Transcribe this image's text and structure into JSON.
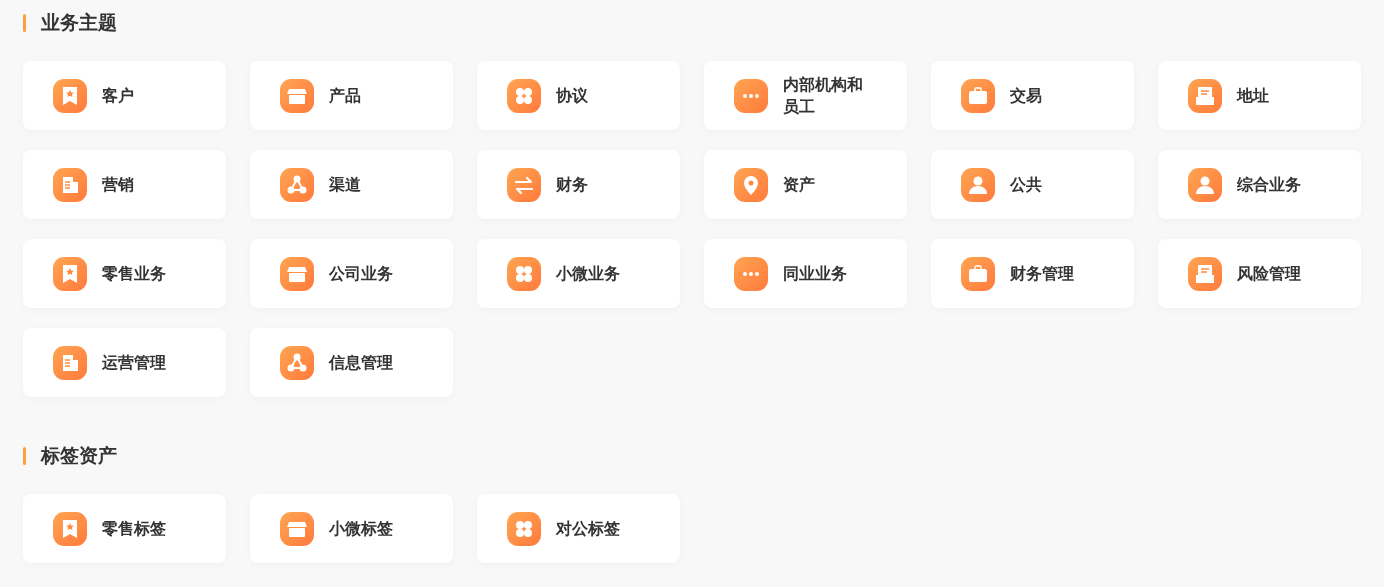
{
  "sections": [
    {
      "title": "业务主题",
      "items": [
        {
          "label": "客户",
          "kind": "bookmark"
        },
        {
          "label": "产品",
          "kind": "store"
        },
        {
          "label": "协议",
          "kind": "grid"
        },
        {
          "label": "内部机构和员工",
          "kind": "dots"
        },
        {
          "label": "交易",
          "kind": "briefcase"
        },
        {
          "label": "地址",
          "kind": "inbox"
        },
        {
          "label": "营销",
          "kind": "building"
        },
        {
          "label": "渠道",
          "kind": "nodes"
        },
        {
          "label": "财务",
          "kind": "swap"
        },
        {
          "label": "资产",
          "kind": "pin"
        },
        {
          "label": "公共",
          "kind": "person"
        },
        {
          "label": "综合业务",
          "kind": "person"
        },
        {
          "label": "零售业务",
          "kind": "bookmark"
        },
        {
          "label": "公司业务",
          "kind": "store"
        },
        {
          "label": "小微业务",
          "kind": "grid"
        },
        {
          "label": "同业业务",
          "kind": "dots"
        },
        {
          "label": "财务管理",
          "kind": "briefcase"
        },
        {
          "label": "风险管理",
          "kind": "inbox"
        },
        {
          "label": "运营管理",
          "kind": "building"
        },
        {
          "label": "信息管理",
          "kind": "nodes"
        }
      ]
    },
    {
      "title": "标签资产",
      "items": [
        {
          "label": "零售标签",
          "kind": "bookmark"
        },
        {
          "label": "小微标签",
          "kind": "store"
        },
        {
          "label": "对公标签",
          "kind": "grid"
        }
      ]
    }
  ]
}
